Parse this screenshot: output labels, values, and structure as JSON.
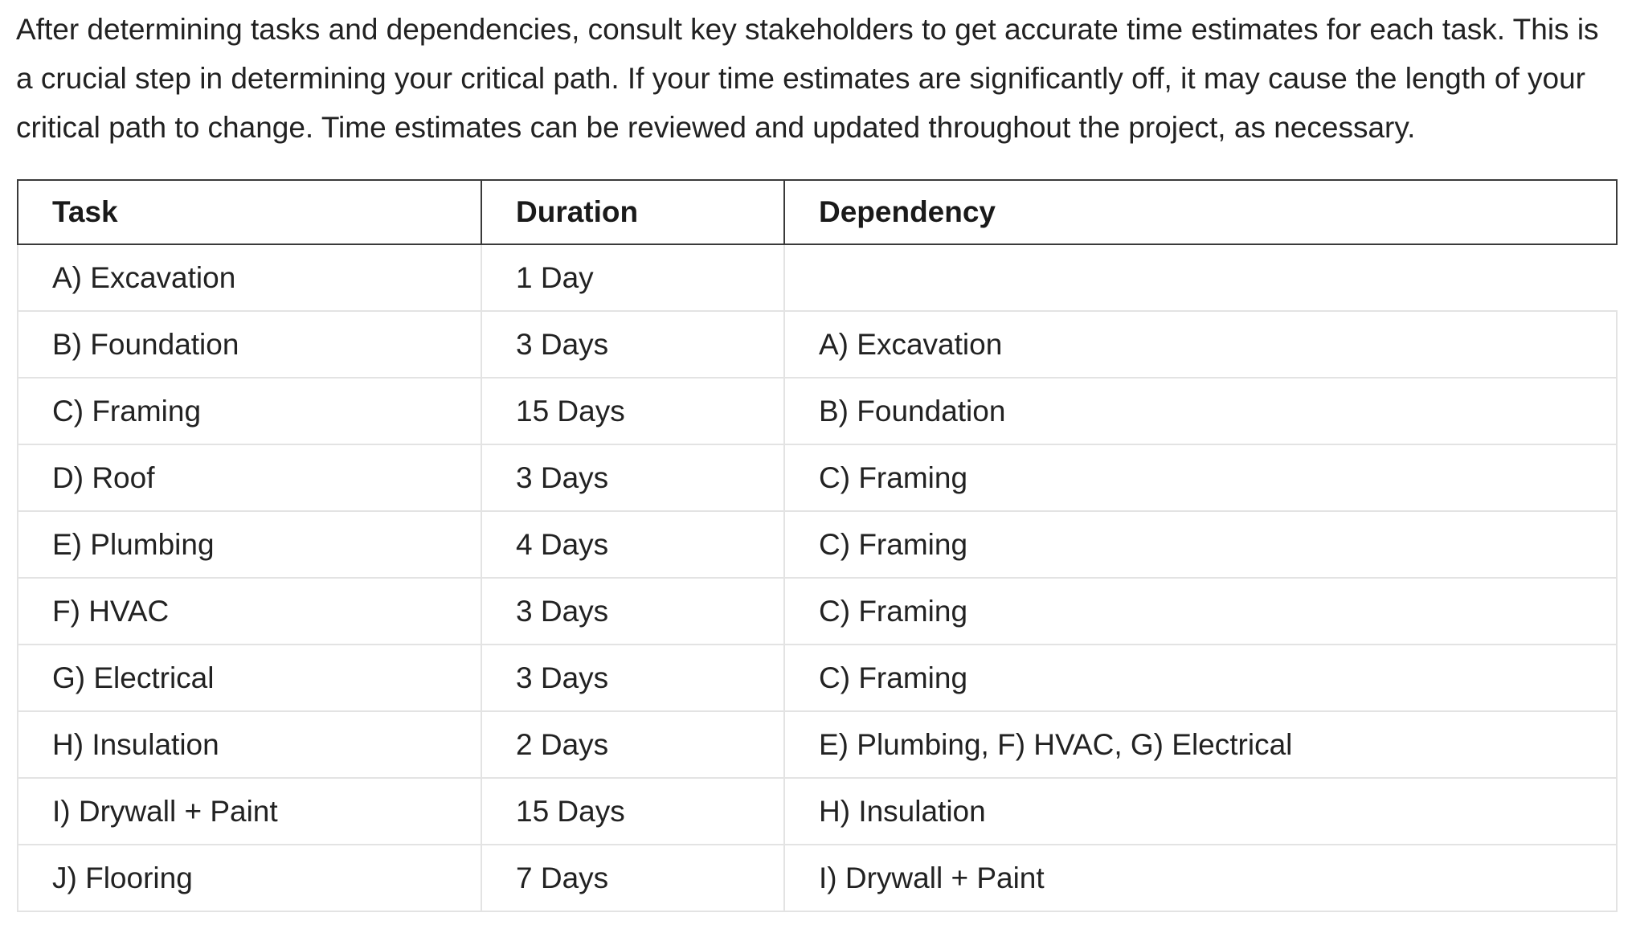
{
  "intro": {
    "text": "After determining tasks and dependencies, consult key stakeholders to get accurate time estimates for each task. This is a crucial step in determining your critical path. If your time estimates are significantly off, it may cause the length of your critical path to change. Time estimates can be reviewed and updated throughout the project, as necessary."
  },
  "table": {
    "headers": {
      "task": "Task",
      "duration": "Duration",
      "dependency": "Dependency"
    },
    "rows": [
      {
        "task": "A) Excavation",
        "duration": "1 Day",
        "dependency": ""
      },
      {
        "task": "B) Foundation",
        "duration": "3 Days",
        "dependency": "A) Excavation"
      },
      {
        "task": "C) Framing",
        "duration": "15 Days",
        "dependency": "B) Foundation"
      },
      {
        "task": "D) Roof",
        "duration": "3 Days",
        "dependency": "C) Framing"
      },
      {
        "task": "E) Plumbing",
        "duration": "4 Days",
        "dependency": "C) Framing"
      },
      {
        "task": "F) HVAC",
        "duration": "3 Days",
        "dependency": "C) Framing"
      },
      {
        "task": "G) Electrical",
        "duration": "3 Days",
        "dependency": "C) Framing"
      },
      {
        "task": "H) Insulation",
        "duration": "2 Days",
        "dependency": "E) Plumbing, F) HVAC, G) Electrical"
      },
      {
        "task": "I) Drywall + Paint",
        "duration": "15 Days",
        "dependency": "H) Insulation"
      },
      {
        "task": "J) Flooring",
        "duration": "7 Days",
        "dependency": "I) Drywall + Paint"
      }
    ]
  }
}
